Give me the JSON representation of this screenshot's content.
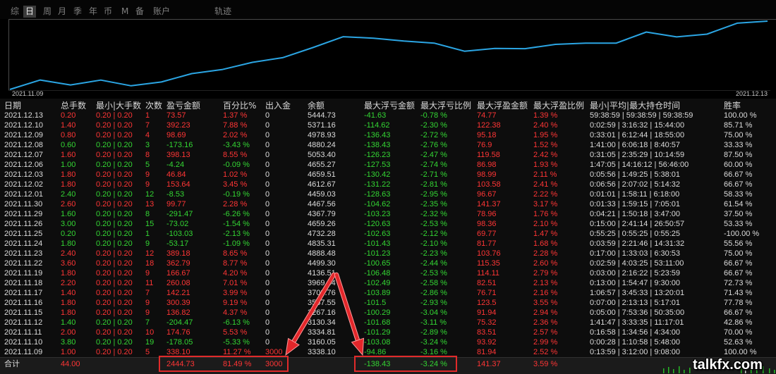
{
  "tabs": [
    {
      "label": "综"
    },
    {
      "label": "日"
    },
    {
      "label": "周"
    },
    {
      "label": "月"
    },
    {
      "label": "季"
    },
    {
      "label": "年"
    },
    {
      "label": "币"
    },
    {
      "label": "M"
    },
    {
      "label": "备"
    },
    {
      "label": "账户"
    },
    {
      "label": "轨迹"
    }
  ],
  "chart": {
    "x_start_label": "2021.11.09",
    "x_end_label": "2021.12.13"
  },
  "table": {
    "headers": [
      "日期",
      "总手数",
      "最小|大手数",
      "次数",
      "盈亏金额",
      "百分比%",
      "出入金",
      "余额",
      "最大浮亏金额",
      "最大浮亏比例",
      "最大浮盈金额",
      "最大浮盈比例",
      "最小|平均|最大持仓时间",
      "胜率"
    ],
    "rows": [
      {
        "date": "2021.12.13",
        "lots": "0.20",
        "minmax": "0.20 | 0.20",
        "count": "1",
        "pnl": "73.57",
        "pct": "1.37 %",
        "flow": "0",
        "balance": "5444.73",
        "float_loss": "-41.63",
        "float_loss_pct": "-0.78 %",
        "float_profit": "74.77",
        "float_profit_pct": "1.39 %",
        "hold_time": "59:38:59 | 59:38:59 | 59:38:59",
        "win_rate": "100.00 %"
      },
      {
        "date": "2021.12.10",
        "lots": "1.40",
        "minmax": "0.20 | 0.20",
        "count": "7",
        "pnl": "392.23",
        "pct": "7.88 %",
        "flow": "0",
        "balance": "5371.16",
        "float_loss": "-114.62",
        "float_loss_pct": "-2.30 %",
        "float_profit": "122.38",
        "float_profit_pct": "2.40 %",
        "hold_time": "0:02:59 | 3:16:32 | 15:44:00",
        "win_rate": "85.71 %"
      },
      {
        "date": "2021.12.09",
        "lots": "0.80",
        "minmax": "0.20 | 0.20",
        "count": "4",
        "pnl": "98.69",
        "pct": "2.02 %",
        "flow": "0",
        "balance": "4978.93",
        "float_loss": "-136.43",
        "float_loss_pct": "-2.72 %",
        "float_profit": "95.18",
        "float_profit_pct": "1.95 %",
        "hold_time": "0:33:01 | 6:12:44 | 18:55:00",
        "win_rate": "75.00 %"
      },
      {
        "date": "2021.12.08",
        "lots": "0.60",
        "minmax": "0.20 | 0.20",
        "count": "3",
        "pnl": "-173.16",
        "pct": "-3.43 %",
        "flow": "0",
        "balance": "4880.24",
        "float_loss": "-138.43",
        "float_loss_pct": "-2.76 %",
        "float_profit": "76.9",
        "float_profit_pct": "1.52 %",
        "hold_time": "1:41:00 | 6:06:18 | 8:40:57",
        "win_rate": "33.33 %"
      },
      {
        "date": "2021.12.07",
        "lots": "1.60",
        "minmax": "0.20 | 0.20",
        "count": "8",
        "pnl": "398.13",
        "pct": "8.55 %",
        "flow": "0",
        "balance": "5053.40",
        "float_loss": "-126.23",
        "float_loss_pct": "-2.47 %",
        "float_profit": "119.58",
        "float_profit_pct": "2.42 %",
        "hold_time": "0:31:05 | 2:35:29 | 10:14:59",
        "win_rate": "87.50 %"
      },
      {
        "date": "2021.12.06",
        "lots": "1.00",
        "minmax": "0.20 | 0.20",
        "count": "5",
        "pnl": "-4.24",
        "pct": "-0.09 %",
        "flow": "0",
        "balance": "4655.27",
        "float_loss": "-127.53",
        "float_loss_pct": "-2.74 %",
        "float_profit": "86.98",
        "float_profit_pct": "1.93 %",
        "hold_time": "1:47:05 | 14:16:12 | 56:46:00",
        "win_rate": "60.00 %"
      },
      {
        "date": "2021.12.03",
        "lots": "1.80",
        "minmax": "0.20 | 0.20",
        "count": "9",
        "pnl": "46.84",
        "pct": "1.02 %",
        "flow": "0",
        "balance": "4659.51",
        "float_loss": "-130.42",
        "float_loss_pct": "-2.71 %",
        "float_profit": "98.99",
        "float_profit_pct": "2.11 %",
        "hold_time": "0:05:56 | 1:49:25 | 5:38:01",
        "win_rate": "66.67 %"
      },
      {
        "date": "2021.12.02",
        "lots": "1.80",
        "minmax": "0.20 | 0.20",
        "count": "9",
        "pnl": "153.64",
        "pct": "3.45 %",
        "flow": "0",
        "balance": "4612.67",
        "float_loss": "-131.22",
        "float_loss_pct": "-2.81 %",
        "float_profit": "103.58",
        "float_profit_pct": "2.41 %",
        "hold_time": "0:06:56 | 2:07:02 | 5:14:32",
        "win_rate": "66.67 %"
      },
      {
        "date": "2021.12.01",
        "lots": "2.40",
        "minmax": "0.20 | 0.20",
        "count": "12",
        "pnl": "-8.53",
        "pct": "-0.19 %",
        "flow": "0",
        "balance": "4459.03",
        "float_loss": "-128.63",
        "float_loss_pct": "-2.95 %",
        "float_profit": "96.67",
        "float_profit_pct": "2.22 %",
        "hold_time": "0:01:01 | 1:58:11 | 6:18:00",
        "win_rate": "58.33 %"
      },
      {
        "date": "2021.11.30",
        "lots": "2.60",
        "minmax": "0.20 | 0.20",
        "count": "13",
        "pnl": "99.77",
        "pct": "2.28 %",
        "flow": "0",
        "balance": "4467.56",
        "float_loss": "-104.62",
        "float_loss_pct": "-2.35 %",
        "float_profit": "141.37",
        "float_profit_pct": "3.17 %",
        "hold_time": "0:01:33 | 1:59:15 | 7:05:01",
        "win_rate": "61.54 %"
      },
      {
        "date": "2021.11.29",
        "lots": "1.60",
        "minmax": "0.20 | 0.20",
        "count": "8",
        "pnl": "-291.47",
        "pct": "-6.26 %",
        "flow": "0",
        "balance": "4367.79",
        "float_loss": "-103.23",
        "float_loss_pct": "-2.32 %",
        "float_profit": "78.96",
        "float_profit_pct": "1.76 %",
        "hold_time": "0:04:21 | 1:50:18 | 3:47:00",
        "win_rate": "37.50 %"
      },
      {
        "date": "2021.11.26",
        "lots": "3.00",
        "minmax": "0.20 | 0.20",
        "count": "15",
        "pnl": "-73.02",
        "pct": "-1.54 %",
        "flow": "0",
        "balance": "4659.26",
        "float_loss": "-120.63",
        "float_loss_pct": "-2.53 %",
        "float_profit": "98.36",
        "float_profit_pct": "2.10 %",
        "hold_time": "0:15:00 | 2:41:14 | 26:50:57",
        "win_rate": "53.33 %"
      },
      {
        "date": "2021.11.25",
        "lots": "0.20",
        "minmax": "0.20 | 0.20",
        "count": "1",
        "pnl": "-103.03",
        "pct": "-2.13 %",
        "flow": "0",
        "balance": "4732.28",
        "float_loss": "-102.63",
        "float_loss_pct": "-2.12 %",
        "float_profit": "69.77",
        "float_profit_pct": "1.47 %",
        "hold_time": "0:55:25 | 0:55:25 | 0:55:25",
        "win_rate": "-100.00 %"
      },
      {
        "date": "2021.11.24",
        "lots": "1.80",
        "minmax": "0.20 | 0.20",
        "count": "9",
        "pnl": "-53.17",
        "pct": "-1.09 %",
        "flow": "0",
        "balance": "4835.31",
        "float_loss": "-101.43",
        "float_loss_pct": "-2.10 %",
        "float_profit": "81.77",
        "float_profit_pct": "1.68 %",
        "hold_time": "0:03:59 | 2:21:46 | 14:31:32",
        "win_rate": "55.56 %"
      },
      {
        "date": "2021.11.23",
        "lots": "2.40",
        "minmax": "0.20 | 0.20",
        "count": "12",
        "pnl": "389.18",
        "pct": "8.65 %",
        "flow": "0",
        "balance": "4888.48",
        "float_loss": "-101.23",
        "float_loss_pct": "-2.23 %",
        "float_profit": "103.76",
        "float_profit_pct": "2.28 %",
        "hold_time": "0:17:00 | 1:33:03 | 6:30:53",
        "win_rate": "75.00 %"
      },
      {
        "date": "2021.11.22",
        "lots": "3.60",
        "minmax": "0.20 | 0.20",
        "count": "18",
        "pnl": "362.79",
        "pct": "8.77 %",
        "flow": "0",
        "balance": "4499.30",
        "float_loss": "-100.65",
        "float_loss_pct": "-2.44 %",
        "float_profit": "115.35",
        "float_profit_pct": "2.60 %",
        "hold_time": "0:02:59 | 4:03:25 | 53:11:00",
        "win_rate": "66.67 %"
      },
      {
        "date": "2021.11.19",
        "lots": "1.80",
        "minmax": "0.20 | 0.20",
        "count": "9",
        "pnl": "166.67",
        "pct": "4.20 %",
        "flow": "0",
        "balance": "4136.51",
        "float_loss": "-106.48",
        "float_loss_pct": "-2.53 %",
        "float_profit": "114.11",
        "float_profit_pct": "2.79 %",
        "hold_time": "0:03:00 | 2:16:22 | 5:23:59",
        "win_rate": "66.67 %"
      },
      {
        "date": "2021.11.18",
        "lots": "2.20",
        "minmax": "0.20 | 0.20",
        "count": "11",
        "pnl": "260.08",
        "pct": "7.01 %",
        "flow": "0",
        "balance": "3969.84",
        "float_loss": "-102.49",
        "float_loss_pct": "-2.58 %",
        "float_profit": "82.51",
        "float_profit_pct": "2.13 %",
        "hold_time": "0:13:00 | 1:54:47 | 9:30:00",
        "win_rate": "72.73 %"
      },
      {
        "date": "2021.11.17",
        "lots": "1.40",
        "minmax": "0.20 | 0.20",
        "count": "7",
        "pnl": "142.21",
        "pct": "3.99 %",
        "flow": "0",
        "balance": "3709.76",
        "float_loss": "-103.89",
        "float_loss_pct": "-2.86 %",
        "float_profit": "76.71",
        "float_profit_pct": "2.16 %",
        "hold_time": "1:06:57 | 3:45:33 | 13:20:01",
        "win_rate": "71.43 %"
      },
      {
        "date": "2021.11.16",
        "lots": "1.80",
        "minmax": "0.20 | 0.20",
        "count": "9",
        "pnl": "300.39",
        "pct": "9.19 %",
        "flow": "0",
        "balance": "3567.55",
        "float_loss": "-101.5",
        "float_loss_pct": "-2.93 %",
        "float_profit": "123.5",
        "float_profit_pct": "3.55 %",
        "hold_time": "0:07:00 | 2:13:13 | 5:17:01",
        "win_rate": "77.78 %"
      },
      {
        "date": "2021.11.15",
        "lots": "1.80",
        "minmax": "0.20 | 0.20",
        "count": "9",
        "pnl": "136.82",
        "pct": "4.37 %",
        "flow": "0",
        "balance": "3267.16",
        "float_loss": "-100.29",
        "float_loss_pct": "-3.04 %",
        "float_profit": "91.94",
        "float_profit_pct": "2.94 %",
        "hold_time": "0:05:00 | 7:53:36 | 50:35:00",
        "win_rate": "66.67 %"
      },
      {
        "date": "2021.11.12",
        "lots": "1.40",
        "minmax": "0.20 | 0.20",
        "count": "7",
        "pnl": "-204.47",
        "pct": "-6.13 %",
        "flow": "0",
        "balance": "3130.34",
        "float_loss": "-101.68",
        "float_loss_pct": "-3.11 %",
        "float_profit": "75.32",
        "float_profit_pct": "2.36 %",
        "hold_time": "1:41:47 | 3:33:35 | 11:17:01",
        "win_rate": "42.86 %"
      },
      {
        "date": "2021.11.11",
        "lots": "2.00",
        "minmax": "0.20 | 0.20",
        "count": "10",
        "pnl": "174.76",
        "pct": "5.53 %",
        "flow": "0",
        "balance": "3334.81",
        "float_loss": "-101.29",
        "float_loss_pct": "-2.89 %",
        "float_profit": "83.51",
        "float_profit_pct": "2.57 %",
        "hold_time": "0:16:58 | 1:34:56 | 4:34:00",
        "win_rate": "70.00 %"
      },
      {
        "date": "2021.11.10",
        "lots": "3.80",
        "minmax": "0.20 | 0.20",
        "count": "19",
        "pnl": "-178.05",
        "pct": "-5.33 %",
        "flow": "0",
        "balance": "3160.05",
        "float_loss": "-103.08",
        "float_loss_pct": "-3.24 %",
        "float_profit": "93.92",
        "float_profit_pct": "2.99 %",
        "hold_time": "0:00:28 | 1:10:58 | 5:48:00",
        "win_rate": "52.63 %"
      },
      {
        "date": "2021.11.09",
        "lots": "1.00",
        "minmax": "0.20 | 0.20",
        "count": "5",
        "pnl": "338.10",
        "pct": "11.27 %",
        "flow": "3000",
        "balance": "3338.10",
        "float_loss": "-94.86",
        "float_loss_pct": "-3.16 %",
        "float_profit": "81.94",
        "float_profit_pct": "2.52 %",
        "hold_time": "0:13:59 | 3:12:00 | 9:08:00",
        "win_rate": "100.00 %"
      }
    ],
    "total": {
      "label": "合计",
      "lots": "44.00",
      "pnl": "2444.73",
      "pct": "81.49 %",
      "flow": "3000",
      "float_loss": "-138.43",
      "float_loss_pct": "-3.24 %",
      "float_profit": "141.37",
      "float_profit_pct": "3.59 %"
    }
  },
  "watermark": "talkfx.com",
  "colors": {
    "up": "#ff3535",
    "down": "#33d633",
    "text": "#dcdcdc",
    "line": "#2ba5e3",
    "highlight": "#e12a2a"
  }
}
